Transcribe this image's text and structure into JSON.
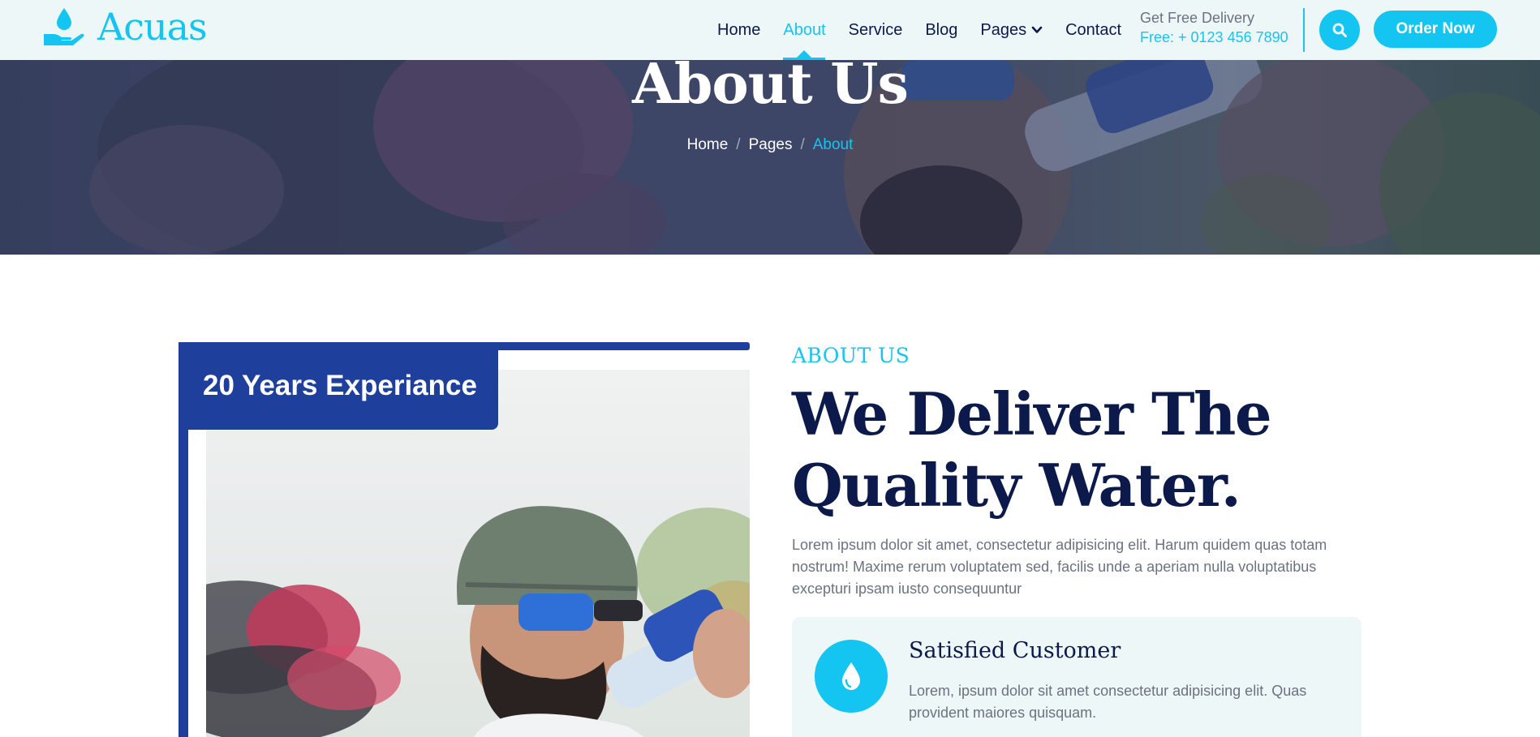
{
  "brand": {
    "name": "Acuas",
    "icon": "water-drop-hand-icon"
  },
  "nav": {
    "links": [
      {
        "label": "Home"
      },
      {
        "label": "About"
      },
      {
        "label": "Service"
      },
      {
        "label": "Blog"
      },
      {
        "label": "Pages"
      },
      {
        "label": "Contact"
      }
    ],
    "active": "About",
    "delivery_label": "Get Free Delivery",
    "delivery_phone": "Free: + 0123 456 7890",
    "order_label": "Order Now"
  },
  "hero": {
    "title": "About Us",
    "breadcrumb": [
      {
        "label": "Home"
      },
      {
        "label": "Pages"
      },
      {
        "label": "About"
      }
    ]
  },
  "about": {
    "experience_badge": "20 Years Experiance",
    "eyebrow": "ABOUT US",
    "headline_line1": "We Deliver The",
    "headline_line2": "Quality Water.",
    "description": "Lorem ipsum dolor sit amet, consectetur adipisicing elit. Harum quidem quas totam nostrum! Maxime rerum voluptatem sed, facilis unde a aperiam nulla voluptatibus excepturi ipsam iusto consequuntur",
    "feature": {
      "title": "Satisfied Customer",
      "description": "Lorem, ipsum dolor sit amet consectetur adipisicing elit. Quas provident maiores quisquam.",
      "icon": "water-drop-icon"
    }
  },
  "colors": {
    "accent": "#13c5f0",
    "navy": "#0b1a4a",
    "badge_blue": "#1e3f9b",
    "nav_bg": "#eef7f8"
  }
}
